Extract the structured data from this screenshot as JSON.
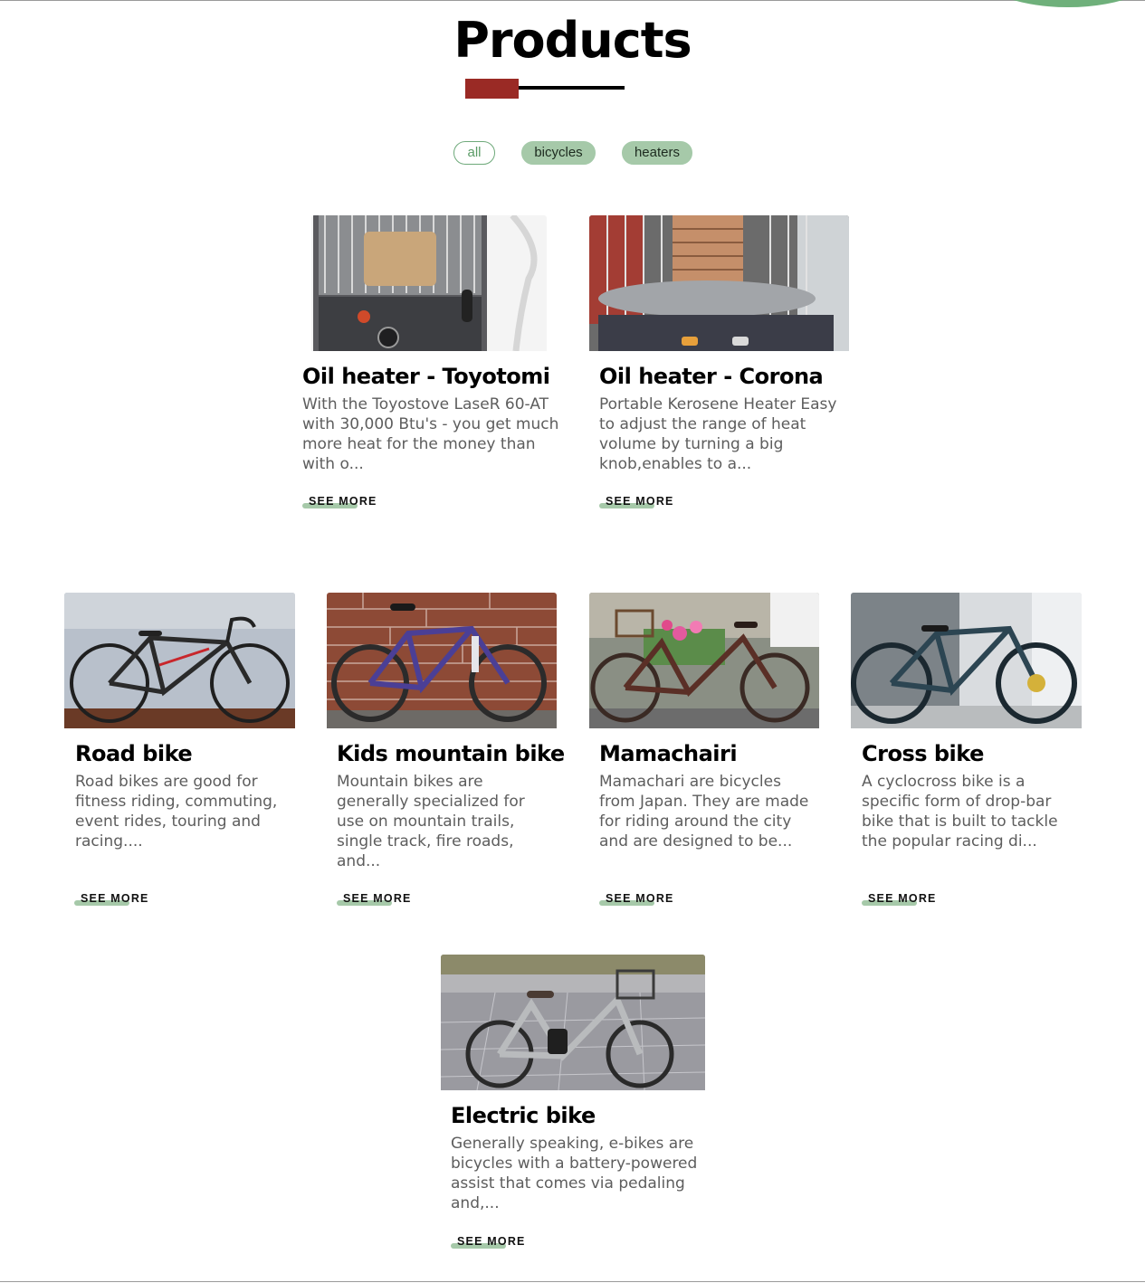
{
  "page": {
    "title": "Products"
  },
  "filters": {
    "all": "all",
    "bicycles": "bicycles",
    "heaters": "heaters"
  },
  "products": [
    {
      "title": "Oil heater - Toyotomi",
      "description": "With the Toyostove LaseR 60-AT with 30,000 Btu's - you get much more heat for the money than with o...",
      "see_more": "SEE MORE",
      "image_icon": "oil-heater"
    },
    {
      "title": "Oil heater - Corona",
      "description": "Portable Kerosene Heater Easy to adjust the range of heat volume by turning a big knob,enables to a...",
      "see_more": "SEE MORE",
      "image_icon": "kerosene-heater"
    },
    {
      "title": "Road bike",
      "description": "Road bikes are good for fitness riding, commuting, event rides, touring and racing....",
      "see_more": "SEE MORE",
      "image_icon": "road-bike"
    },
    {
      "title": "Kids mountain bike",
      "description": "Mountain bikes are generally specialized for use on mountain trails, single track, fire roads, and...",
      "see_more": "SEE MORE",
      "image_icon": "mountain-bike"
    },
    {
      "title": "Mamachairi",
      "description": "Mamachari are bicycles from Japan. They are made for riding around the city and are designed to be...",
      "see_more": "SEE MORE",
      "image_icon": "city-bike"
    },
    {
      "title": "Cross bike",
      "description": "A cyclocross bike is a specific form of drop-bar bike that is built to tackle the popular racing di...",
      "see_more": "SEE MORE",
      "image_icon": "cross-bike"
    },
    {
      "title": "Electric bike",
      "description": "Generally speaking, e-bikes are bicycles with a battery-powered assist that comes via pedaling and,...",
      "see_more": "SEE MORE",
      "image_icon": "electric-bike"
    }
  ],
  "colors": {
    "accent_green": "#a6c9a9",
    "title_red": "#9a2a25",
    "description_gray": "#5d5d5d"
  }
}
